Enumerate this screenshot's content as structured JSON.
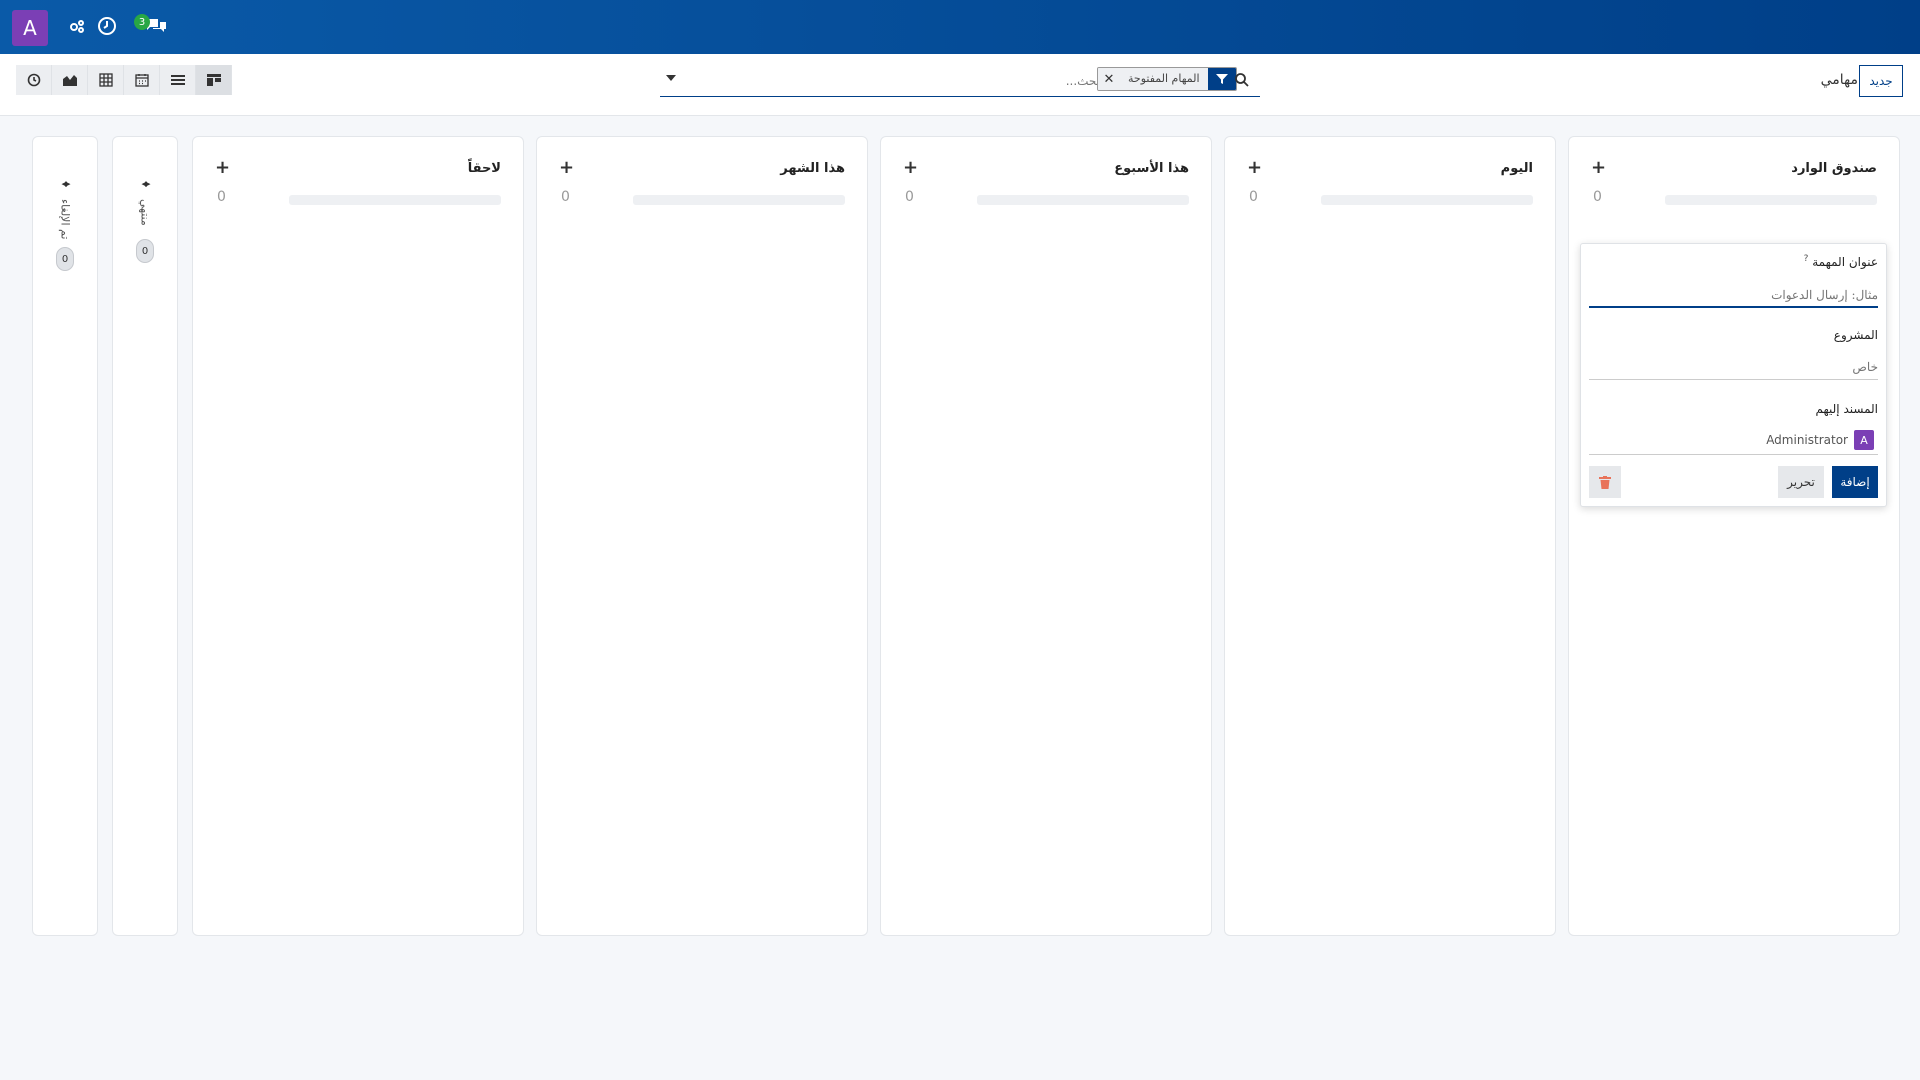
{
  "navbar": {
    "avatar_letter": "A",
    "messages_badge": "3",
    "icons": [
      "activity-icon",
      "clock-icon",
      "messages-icon"
    ]
  },
  "control": {
    "new_button": "جديد",
    "breadcrumb": "مهامي",
    "search_placeholder": "بحث...",
    "facet_label": "المهام المفتوحة",
    "view_icons": [
      "kanban-icon",
      "list-icon",
      "calendar-icon",
      "pivot-icon",
      "graph-icon",
      "activity-icon"
    ]
  },
  "columns": [
    {
      "title": "صندوق الوارد",
      "count": "0"
    },
    {
      "title": "اليوم",
      "count": "0"
    },
    {
      "title": "هذا الأسبوع",
      "count": "0"
    },
    {
      "title": "هذا الشهر",
      "count": "0"
    },
    {
      "title": "لاحقاً",
      "count": "0"
    }
  ],
  "folded_columns": [
    {
      "title": "منتهي",
      "count": "0"
    },
    {
      "title": "تم الإلغاء",
      "count": "0"
    }
  ],
  "quick_create": {
    "title_label": "عنوان المهمة",
    "title_help": "?",
    "title_placeholder": "مثال: إرسال الدعوات",
    "project_label": "المشروع",
    "project_placeholder": "خاص",
    "assignees_label": "المسند إليهم",
    "assignee_name": "Administrator",
    "assignee_letter": "A",
    "add_button": "إضافة",
    "edit_button": "تحرير"
  },
  "colors": {
    "navbar": "#003f88",
    "accent": "#003f88",
    "avatar": "#7b3fb5",
    "badge": "#28a745",
    "delete": "#e8735a"
  }
}
